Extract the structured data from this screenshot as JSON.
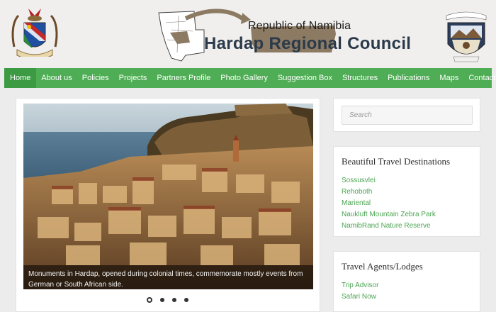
{
  "header": {
    "republic": "Republic of Namibia",
    "council": "Hardap Regional Council",
    "seal_text": "Hardap Regional Council"
  },
  "nav": {
    "items": [
      "Home",
      "About us",
      "Policies",
      "Projects",
      "Partners Profile",
      "Photo Gallery",
      "Suggestion Box",
      "Structures",
      "Publications",
      "Maps",
      "Contacts"
    ],
    "active": "Home"
  },
  "slider": {
    "caption": "Monuments in Hardap, opened during colonial times, commemorate mostly events from German or South African side.",
    "slide_count": 4,
    "active_slide": 1
  },
  "search": {
    "placeholder": "Search"
  },
  "destinations": {
    "title": "Beautiful Travel Destinations",
    "items": [
      "Sossusvlei",
      "Rehoboth",
      "Mariental",
      "Naukluft Mountain Zebra Park",
      "NamibRand Nature Reserve"
    ]
  },
  "agents": {
    "title": "Travel Agents/Lodges",
    "items": [
      "Trip Advisor",
      "Safari Now"
    ]
  },
  "colors": {
    "nav_green": "#4fae55",
    "link_green": "#4ca553",
    "page_bg": "#ececec"
  }
}
